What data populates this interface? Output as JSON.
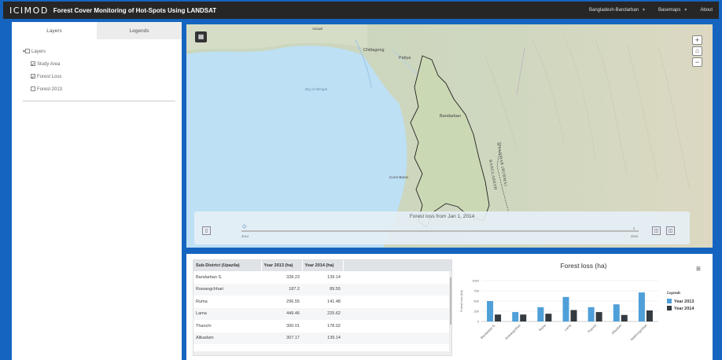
{
  "header": {
    "logo": "ICIMOD",
    "title": "Forest Cover Monitoring of Hot-Spots Using LANDSAT",
    "nav": [
      {
        "label": "Bangladesh-Bandarban"
      },
      {
        "label": "Basemaps"
      },
      {
        "label": "About"
      }
    ]
  },
  "sidebar": {
    "tabs": [
      {
        "label": "Layers"
      },
      {
        "label": "Legends"
      }
    ],
    "root": {
      "label": "Layers"
    },
    "layers": [
      {
        "label": "Study Area",
        "checked": true
      },
      {
        "label": "Forest Loss",
        "checked": true
      },
      {
        "label": "Forest 2013",
        "checked": false
      }
    ]
  },
  "map": {
    "labels": {
      "chittagong": "Chittagong",
      "patiya": "Patiya",
      "bandarban": "Bandarban",
      "bay": "Bay of Bengal",
      "cox": "Cox's Bazar",
      "aizawl": "Aizawl",
      "myanmar": "MYANMAR (BURMA)",
      "bangladesh": "BANGLADESH"
    },
    "slider": {
      "title": "Forest loss from Jan 1, 2014",
      "start": "2014",
      "end": "2015",
      "end_num": "3"
    }
  },
  "table": {
    "columns": [
      "Sub-District (Upazila)",
      "Year 2013 (ha)",
      "Year 2014 (ha)"
    ],
    "rows": [
      [
        "Bandarban S.",
        "328.23",
        "139.14"
      ],
      [
        "Rowangchhari",
        "187.2",
        "89.55"
      ],
      [
        "Ruma",
        "296.55",
        "141.48"
      ],
      [
        "Lama",
        "449.46",
        "225.62"
      ],
      [
        "Thanchi",
        "300.01",
        "178.02"
      ],
      [
        "Alikadam",
        "307.17",
        "139.14"
      ]
    ]
  },
  "chart_data": {
    "type": "bar",
    "title": "Forest loss (ha)",
    "ylabel": "Forest loss (ha)",
    "xlabel": "",
    "ylim": [
      0,
      1000
    ],
    "yticks": [
      "0",
      "250",
      "500",
      "750",
      "1000"
    ],
    "categories": [
      "Bandarban S.",
      "Rowangchhari",
      "Ruma",
      "Lama",
      "Thanchi",
      "Alikadam",
      "Naikhongchhari"
    ],
    "legend_title": "Legends",
    "legend_position": "right",
    "series": [
      {
        "name": "Year 2013",
        "color": "#4f9fd8",
        "values": [
          500,
          230,
          350,
          600,
          350,
          420,
          710
        ]
      },
      {
        "name": "Year 2014",
        "color": "#333a40",
        "values": [
          170,
          170,
          190,
          280,
          230,
          160,
          270
        ]
      }
    ]
  }
}
